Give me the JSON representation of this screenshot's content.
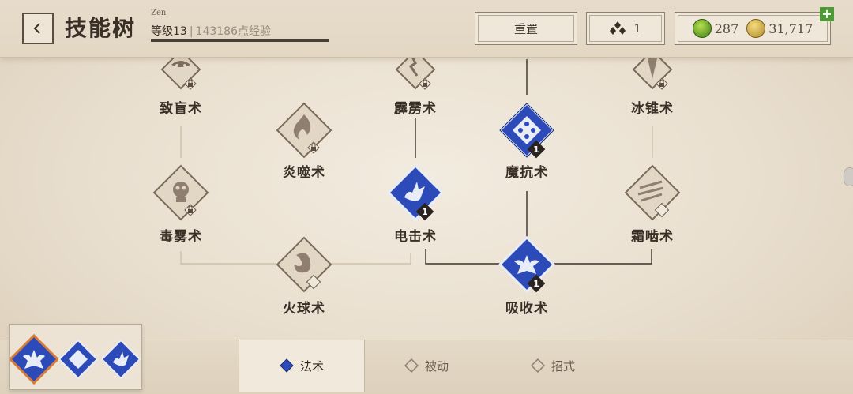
{
  "header": {
    "title": "技能树",
    "player_name": "Zen",
    "level_text": "等级13",
    "xp_text": "143186点经验",
    "reset_label": "重置",
    "skill_points": "1",
    "currency_green": "287",
    "currency_gold": "31,717",
    "plus_label": "+"
  },
  "nodes": [
    {
      "id": "blind",
      "label": "致盲术",
      "locked": true,
      "active": false
    },
    {
      "id": "mist",
      "label": "霹雳术",
      "locked": true,
      "active": false
    },
    {
      "id": "icecone",
      "label": "冰锥术",
      "locked": true,
      "active": false
    },
    {
      "id": "flame",
      "label": "炎噬术",
      "locked": true,
      "active": false
    },
    {
      "id": "antimagic",
      "label": "魔抗术",
      "locked": false,
      "active": true,
      "rank": "1"
    },
    {
      "id": "poison",
      "label": "毒雾术",
      "locked": true,
      "active": false
    },
    {
      "id": "shock",
      "label": "电击术",
      "locked": false,
      "active": true,
      "rank": "1"
    },
    {
      "id": "frost",
      "label": "霜啮术",
      "locked": false,
      "active": false
    },
    {
      "id": "fireball",
      "label": "火球术",
      "locked": false,
      "active": false
    },
    {
      "id": "absorb",
      "label": "吸收术",
      "locked": false,
      "active": true,
      "rank": "1"
    }
  ],
  "tabs": [
    {
      "label": "法术",
      "active": true
    },
    {
      "label": "被动",
      "active": false
    },
    {
      "label": "招式",
      "active": false
    }
  ],
  "colors": {
    "active_blue": "#2d4bb8",
    "ink": "#3a2f26",
    "green_plus": "#4e9a36",
    "loadout_orange": "#d77b3a"
  }
}
